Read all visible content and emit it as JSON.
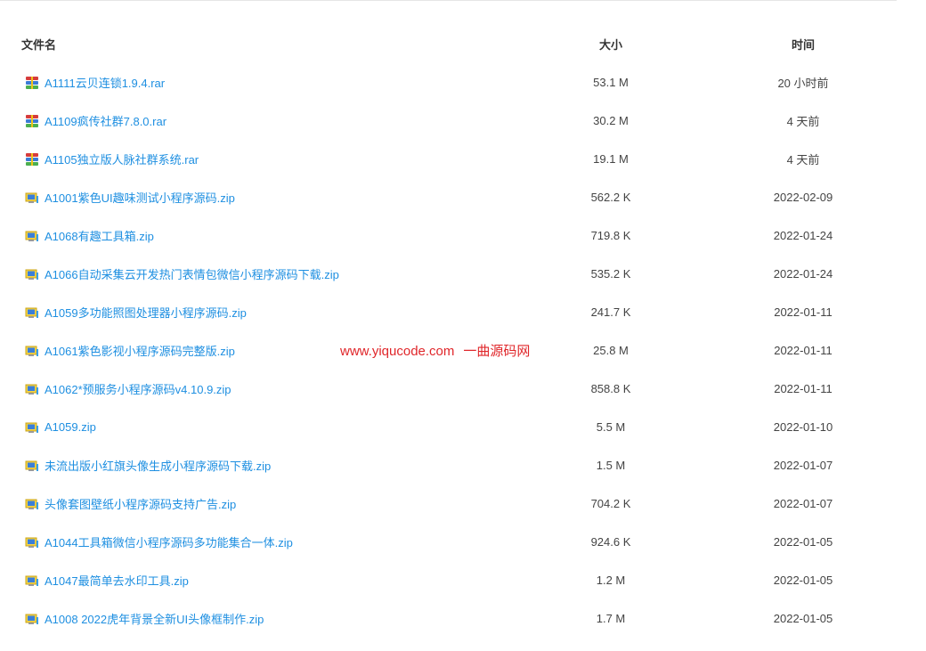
{
  "table": {
    "headers": {
      "name": "文件名",
      "size": "大小",
      "time": "时间"
    },
    "rows": [
      {
        "name": "A1111云贝连锁1.9.4.rar",
        "size": "53.1 M",
        "time": "20 小时前",
        "icon": "rar-archive-icon"
      },
      {
        "name": "A1109疯传社群7.8.0.rar",
        "size": "30.2 M",
        "time": "4 天前",
        "icon": "rar-archive-icon"
      },
      {
        "name": "A1105独立版人脉社群系统.rar",
        "size": "19.1 M",
        "time": "4 天前",
        "icon": "rar-archive-icon"
      },
      {
        "name": "A1001紫色UI趣味测试小程序源码.zip",
        "size": "562.2 K",
        "time": "2022-02-09",
        "icon": "zip-file-icon"
      },
      {
        "name": "A1068有趣工具箱.zip",
        "size": "719.8 K",
        "time": "2022-01-24",
        "icon": "zip-file-icon"
      },
      {
        "name": "A1066自动采集云开发热门表情包微信小程序源码下载.zip",
        "size": "535.2 K",
        "time": "2022-01-24",
        "icon": "zip-file-icon"
      },
      {
        "name": "A1059多功能照图处理器小程序源码.zip",
        "size": "241.7 K",
        "time": "2022-01-11",
        "icon": "zip-file-icon"
      },
      {
        "name": "A1061紫色影视小程序源码完整版.zip",
        "size": "25.8 M",
        "time": "2022-01-11",
        "icon": "zip-file-icon"
      },
      {
        "name": "A1062*预服务小程序源码v4.10.9.zip",
        "size": "858.8 K",
        "time": "2022-01-11",
        "icon": "zip-file-icon"
      },
      {
        "name": "A1059.zip",
        "size": "5.5 M",
        "time": "2022-01-10",
        "icon": "zip-file-icon"
      },
      {
        "name": "未流出版小红旗头像生成小程序源码下载.zip",
        "size": "1.5 M",
        "time": "2022-01-07",
        "icon": "zip-file-icon"
      },
      {
        "name": "头像套图壁纸小程序源码支持广告.zip",
        "size": "704.2 K",
        "time": "2022-01-07",
        "icon": "zip-file-icon"
      },
      {
        "name": "A1044工具箱微信小程序源码多功能集合一体.zip",
        "size": "924.6 K",
        "time": "2022-01-05",
        "icon": "zip-file-icon"
      },
      {
        "name": "A1047最简单去水印工具.zip",
        "size": "1.2 M",
        "time": "2022-01-05",
        "icon": "zip-file-icon"
      },
      {
        "name": "A1008 2022虎年背景全新UI头像框制作.zip",
        "size": "1.7 M",
        "time": "2022-01-05",
        "icon": "zip-file-icon"
      }
    ]
  },
  "watermark": {
    "url": "www.yiqucode.com",
    "site_name": "一曲源码网"
  },
  "colors": {
    "link": "#1e8fe1",
    "watermark": "#e0262a",
    "text": "#333333"
  }
}
